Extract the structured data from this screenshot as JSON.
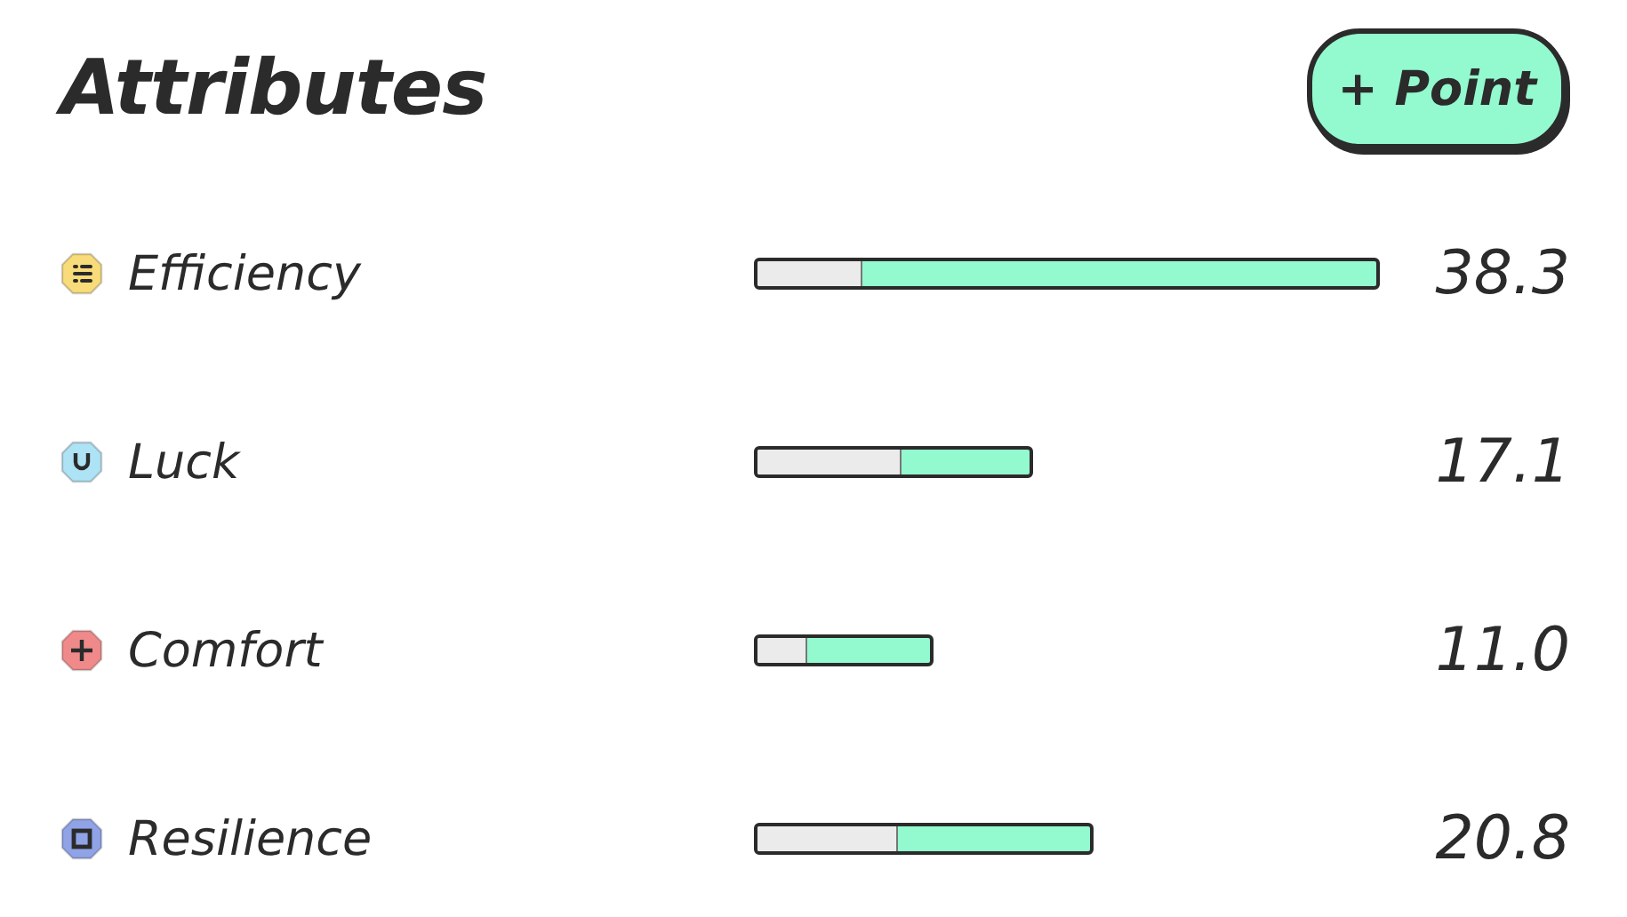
{
  "title": "Attributes",
  "add_button": {
    "label": "+ Point"
  },
  "attributes": [
    {
      "name": "Efficiency",
      "kind": "list",
      "color": "#f9dc7a",
      "value": "38.3",
      "base": {
        "level": 0.17
      }
    },
    {
      "name": "Luck",
      "kind": "magnet",
      "color": "#aee3f6",
      "value": "17.1",
      "base": {
        "level": 0.53
      }
    },
    {
      "name": "Comfort",
      "kind": "plus",
      "color": "#f08a8a",
      "value": "11.0",
      "base": {
        "level": 0.29
      }
    },
    {
      "name": "Resilience",
      "kind": "square",
      "color": "#8fa3e6",
      "value": "20.8",
      "base": {
        "level": 0.42
      }
    }
  ]
}
